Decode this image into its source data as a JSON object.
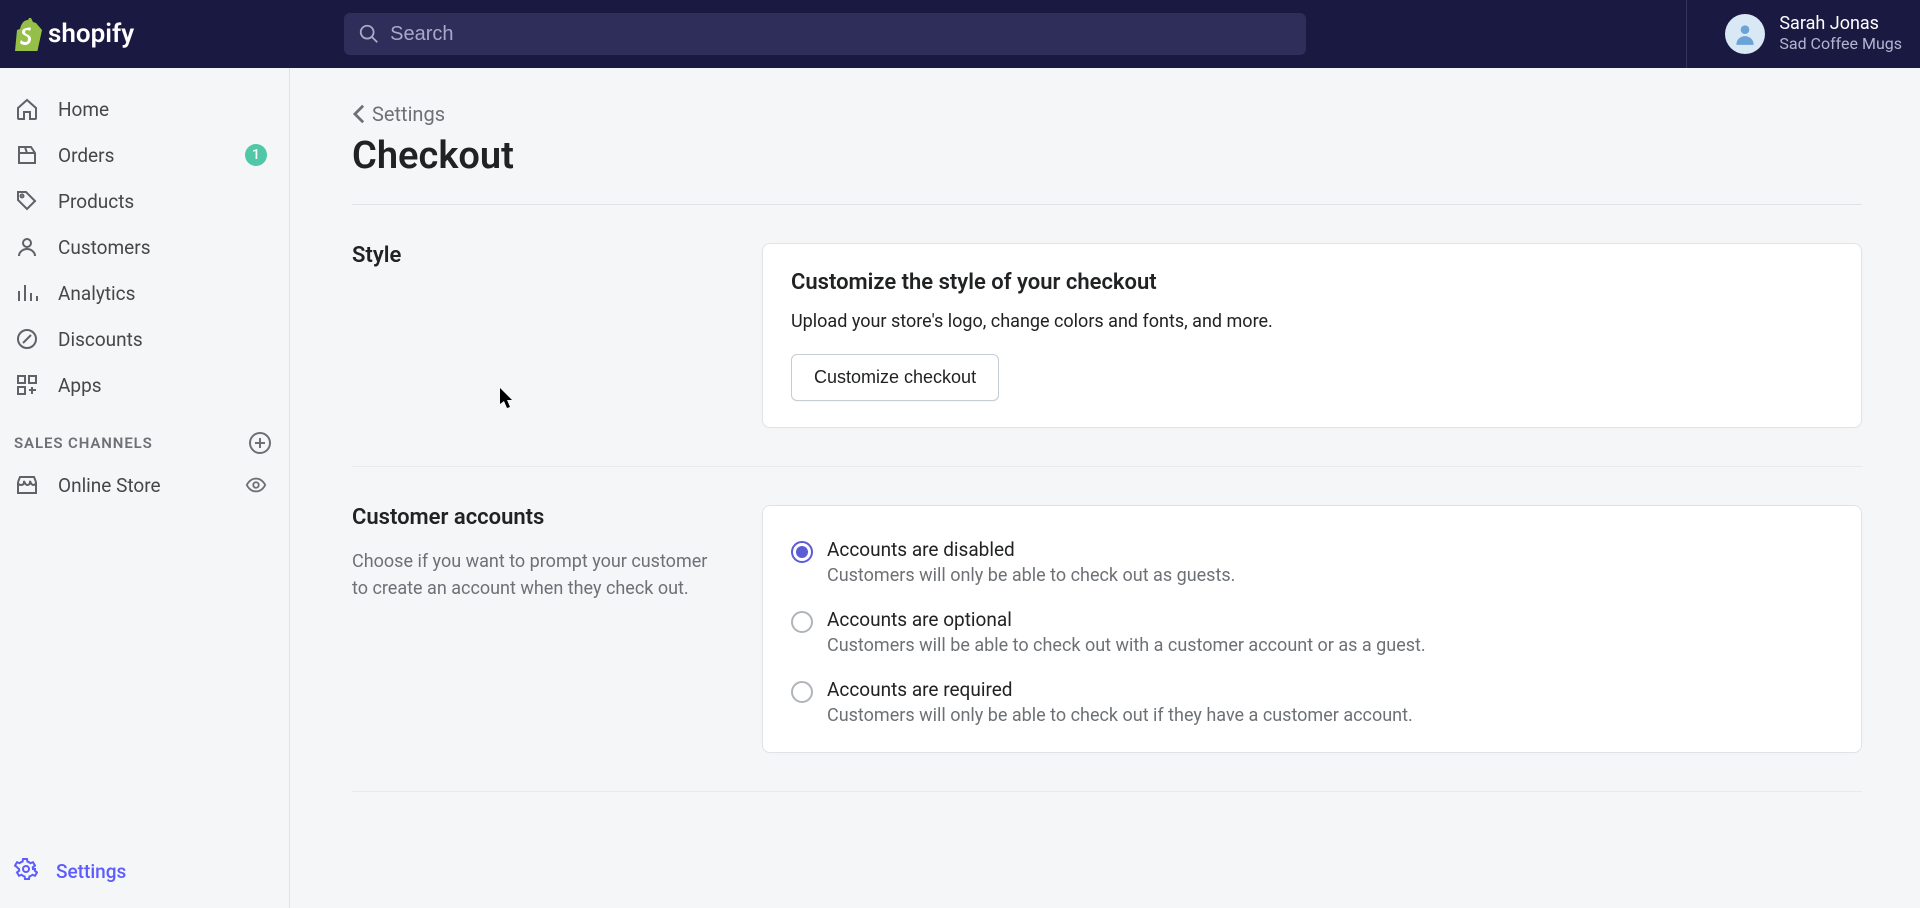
{
  "topbar": {
    "search_placeholder": "Search",
    "user_name": "Sarah Jonas",
    "store_name": "Sad Coffee Mugs"
  },
  "sidebar": {
    "items": [
      {
        "id": "home",
        "label": "Home",
        "icon": "home-icon"
      },
      {
        "id": "orders",
        "label": "Orders",
        "icon": "orders-icon",
        "badge": "1"
      },
      {
        "id": "products",
        "label": "Products",
        "icon": "tag-icon"
      },
      {
        "id": "customers",
        "label": "Customers",
        "icon": "person-icon"
      },
      {
        "id": "analytics",
        "label": "Analytics",
        "icon": "analytics-icon"
      },
      {
        "id": "discounts",
        "label": "Discounts",
        "icon": "discount-icon"
      },
      {
        "id": "apps",
        "label": "Apps",
        "icon": "apps-icon"
      }
    ],
    "section_header": "SALES CHANNELS",
    "channels": [
      {
        "id": "online-store",
        "label": "Online Store",
        "icon": "store-icon"
      }
    ],
    "settings_label": "Settings"
  },
  "main": {
    "breadcrumb": "Settings",
    "page_title": "Checkout",
    "style_section": {
      "aside_title": "Style",
      "card_title": "Customize the style of your checkout",
      "card_desc": "Upload your store's logo, change colors and fonts, and more.",
      "button_label": "Customize checkout"
    },
    "accounts_section": {
      "aside_title": "Customer accounts",
      "aside_desc": "Choose if you want to prompt your customer to create an account when they check out.",
      "options": [
        {
          "title": "Accounts are disabled",
          "desc": "Customers will only be able to check out as guests.",
          "selected": true
        },
        {
          "title": "Accounts are optional",
          "desc": "Customers will be able to check out with a customer account or as a guest.",
          "selected": false
        },
        {
          "title": "Accounts are required",
          "desc": "Customers will only be able to check out if they have a customer account.",
          "selected": false
        }
      ]
    }
  }
}
